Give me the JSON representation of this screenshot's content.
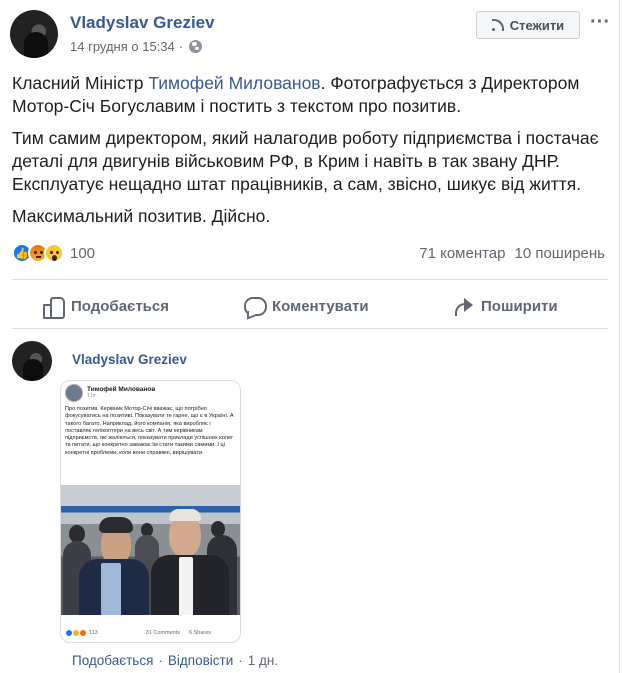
{
  "post": {
    "author": "Vladyslav Greziev",
    "timestamp": "14 грудня о 15:34",
    "follow_label": "Стежити",
    "more_label": "···",
    "text_before_mention": "Класний Міністр ",
    "mention": "Тимофей Милованов",
    "text_after_mention": ". Фотографується з Директором Мотор-Січ Богуславим і постить з текстом про позитив.",
    "paragraph2": "Тим самим директором, який налагодив роботу підприємства і постачає деталі для двигунів військовим РФ, в Крим і навіть в так звану ДНР. Експлуатує нещадно штат працівників, а сам, звісно, шикує від життя.",
    "paragraph3": "Максимальний позитив. Дійсно.",
    "reactions_count": "100",
    "comments_count": "71 коментар",
    "shares_count": "10 поширень",
    "actions": {
      "like": "Подобається",
      "comment": "Коментувати",
      "share": "Поширити"
    }
  },
  "comment": {
    "author": "Vladyslav Greziev",
    "like_label": "Подобається",
    "reply_label": "Відповісти",
    "time": "1 дн.",
    "separator": "·",
    "image": {
      "author": "Тимофей Милованов",
      "time": "1 hr · ",
      "text": "Про позитив. Керівник Мотор-Січі вважає, що потрібно фокусуватись на позитиві. Показувати те гарне, що є в Україні. А такого багато. Наприклад, його компанія, яка виробляє і поставляє гелікоптери на весь світ. А тим керівникам підприємств, які жаліються, показувати приклади успішних колег та питати, що конкретно заважає їм стати такими самими. І ці конкретні проблеми, коли вони справжні, вирішувати.",
      "reactions_count": "113",
      "comments": "31 Comments",
      "shares": "6 Shares"
    }
  },
  "colors": {
    "link": "#385898",
    "secondary_text": "#606770",
    "like_blue": "#1877f2"
  }
}
